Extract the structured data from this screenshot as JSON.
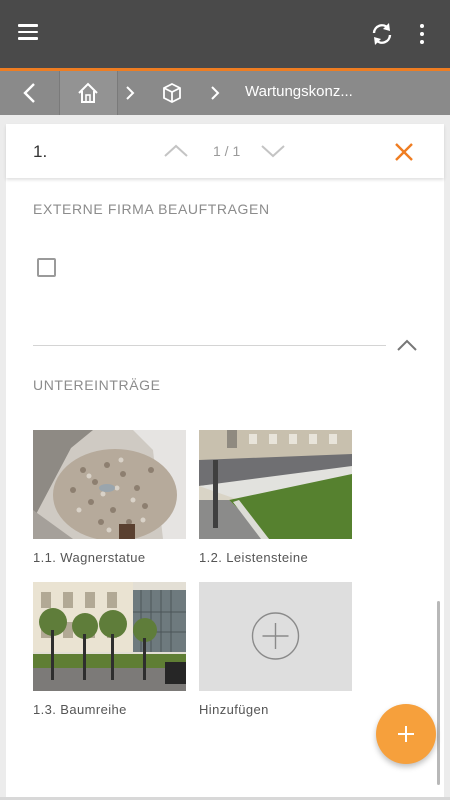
{
  "toolbar": {
    "menu_icon": "hamburger-menu-icon",
    "sync_icon": "sync-icon",
    "more_icon": "more-vertical-icon",
    "accent_color": "#ef7d22"
  },
  "breadcrumb": {
    "back_icon": "chevron-left-icon",
    "home_icon": "home-icon",
    "separator_icon": "chevron-right-icon",
    "object_icon": "cube-icon",
    "current": "Wartungskonz..."
  },
  "entry": {
    "number": "1.",
    "pager": "1 / 1",
    "prev_icon": "chevron-up-icon",
    "next_icon": "chevron-down-icon",
    "close_icon": "close-icon"
  },
  "externe_firma": {
    "label": "EXTERNE FIRMA BEAUFTRAGEN",
    "checked": false
  },
  "untereintraege": {
    "label": "UNTEREINTRÄGE",
    "items": [
      {
        "label": "1.1. Wagnerstatue",
        "image": "gravel-fountain-photo"
      },
      {
        "label": "1.2. Leistensteine",
        "image": "lawn-curb-photo"
      },
      {
        "label": "1.3. Baumreihe",
        "image": "tree-row-photo"
      }
    ],
    "add_label": "Hinzufügen",
    "add_icon": "plus-circle-icon"
  },
  "fab": {
    "icon": "plus-icon",
    "color": "#f6a03c"
  }
}
